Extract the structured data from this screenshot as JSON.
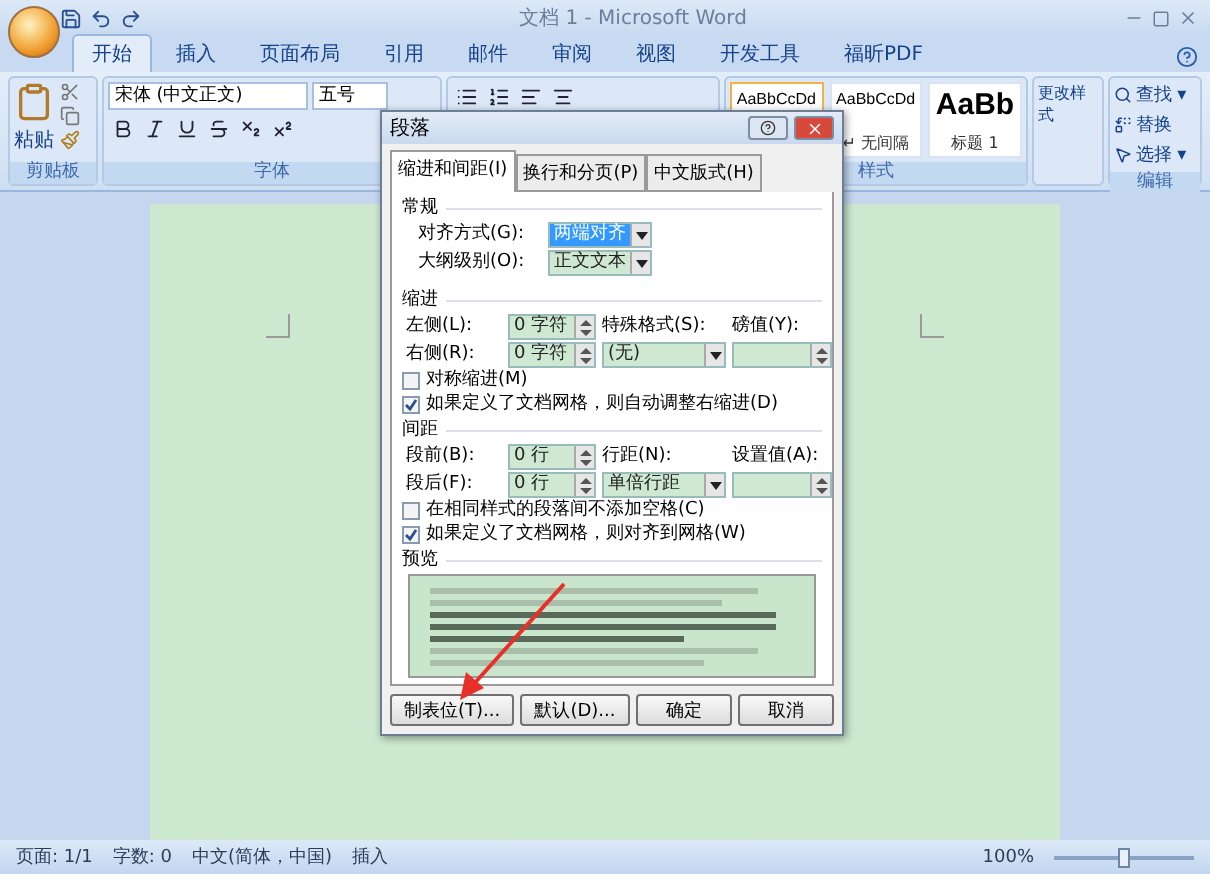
{
  "window": {
    "title": "文档 1 - Microsoft Word"
  },
  "ribbon_tabs": [
    {
      "label": "开始",
      "selected": true
    },
    {
      "label": "插入",
      "selected": false
    },
    {
      "label": "页面布局",
      "selected": false
    },
    {
      "label": "引用",
      "selected": false
    },
    {
      "label": "邮件",
      "selected": false
    },
    {
      "label": "审阅",
      "selected": false
    },
    {
      "label": "视图",
      "selected": false
    },
    {
      "label": "开发工具",
      "selected": false
    },
    {
      "label": "福昕PDF",
      "selected": false
    }
  ],
  "clipboard": {
    "paste_label": "粘贴",
    "group_label": "剪贴板"
  },
  "font": {
    "font_name": "宋体 (中文正文)",
    "font_size": "五号",
    "group_label": "字体"
  },
  "styles": {
    "items": [
      {
        "sample": "AaBbCcDd",
        "selected": true,
        "kind": "small"
      },
      {
        "sample": "AaBbCcDd",
        "name": "↵ 无间隔",
        "selected": false,
        "kind": "small"
      },
      {
        "sample": "AaBb",
        "name": "标题 1",
        "selected": false,
        "kind": "large"
      }
    ],
    "change_label": "更改样式",
    "group_label": "样式"
  },
  "editing": {
    "items": [
      "查找 ▾",
      "替换",
      "选择 ▾"
    ],
    "group_label": "编辑"
  },
  "dialog": {
    "title": "段落",
    "tabs": [
      {
        "label": "缩进和间距(I)",
        "selected": true
      },
      {
        "label": "换行和分页(P)",
        "selected": false
      },
      {
        "label": "中文版式(H)",
        "selected": false
      }
    ],
    "general": {
      "heading": "常规",
      "alignment_label": "对齐方式(G):",
      "alignment": "两端对齐",
      "outline_label": "大纲级别(O):",
      "outline": "正文文本"
    },
    "indent": {
      "heading": "缩进",
      "left_label": "左侧(L):",
      "left": "0 字符",
      "right_label": "右侧(R):",
      "right": "0 字符",
      "special_label": "特殊格式(S):",
      "special": "(无)",
      "by_label": "磅值(Y):",
      "options": [
        {
          "label": "对称缩进(M)",
          "checked": false
        },
        {
          "label": "如果定义了文档网格，则自动调整右缩进(D)",
          "checked": true
        }
      ]
    },
    "spacing": {
      "heading": "间距",
      "before_label": "段前(B):",
      "before": "0 行",
      "after_label": "段后(F):",
      "after": "0 行",
      "line_label": "行距(N):",
      "line": "单倍行距",
      "at_label": "设置值(A):",
      "options": [
        {
          "label": "在相同样式的段落间不添加空格(C)",
          "checked": false
        },
        {
          "label": "如果定义了文档网格，则对齐到网格(W)",
          "checked": true
        }
      ]
    },
    "preview_heading": "预览",
    "buttons": [
      "制表位(T)...",
      "默认(D)...",
      "确定",
      "取消"
    ]
  },
  "status_bar": {
    "items": [
      "页面: 1/1",
      "字数: 0",
      "中文(简体，中国)",
      "插入"
    ],
    "zoom": "100%",
    "zoom_level": {
      "level": 0.5
    }
  }
}
